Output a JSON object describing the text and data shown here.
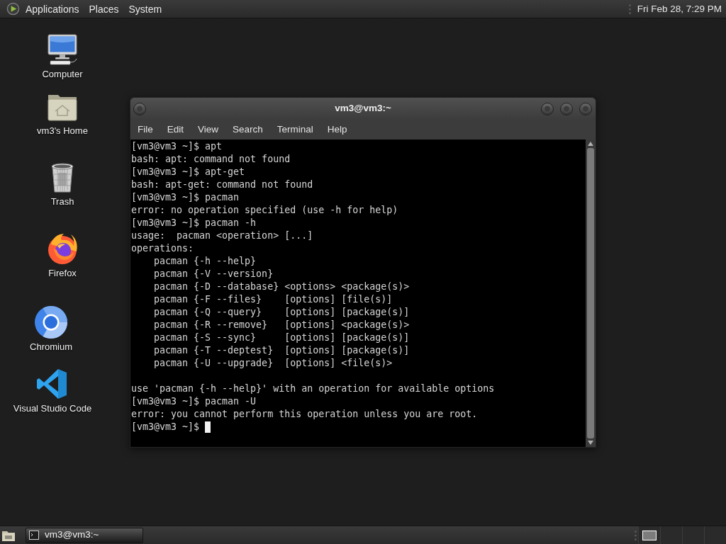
{
  "top_panel": {
    "menus": [
      "Applications",
      "Places",
      "System"
    ],
    "clock": "Fri Feb 28, 7:29 PM"
  },
  "desktop_icons": [
    {
      "label": "Computer",
      "kind": "computer"
    },
    {
      "label": "vm3's Home",
      "kind": "home"
    },
    {
      "label": "Trash",
      "kind": "trash"
    },
    {
      "label": "Firefox",
      "kind": "firefox"
    },
    {
      "label": "Chromium",
      "kind": "chromium"
    },
    {
      "label": "Visual Studio Code",
      "kind": "vscode"
    }
  ],
  "window": {
    "title": "vm3@vm3:~",
    "menus": [
      "File",
      "Edit",
      "View",
      "Search",
      "Terminal",
      "Help"
    ],
    "terminal": {
      "lines": [
        {
          "kind": "text",
          "text": "[vm3@vm3 ~]$ apt"
        },
        {
          "kind": "text",
          "text": "bash: apt: command not found"
        },
        {
          "kind": "text",
          "text": "[vm3@vm3 ~]$ apt-get"
        },
        {
          "kind": "text",
          "text": "bash: apt-get: command not found"
        },
        {
          "kind": "text",
          "text": "[vm3@vm3 ~]$ pacman"
        },
        {
          "kind": "text",
          "text": "error: no operation specified (use -h for help)"
        },
        {
          "kind": "text",
          "text": "[vm3@vm3 ~]$ pacman -h"
        },
        {
          "kind": "text",
          "text": "usage:  pacman <operation> [...]"
        },
        {
          "kind": "text",
          "text": "operations:"
        },
        {
          "kind": "text",
          "text": "    pacman {-h --help}"
        },
        {
          "kind": "text",
          "text": "    pacman {-V --version}"
        },
        {
          "kind": "text",
          "text": "    pacman {-D --database} <options> <package(s)>"
        },
        {
          "kind": "text",
          "text": "    pacman {-F --files}    [options] [file(s)]"
        },
        {
          "kind": "text",
          "text": "    pacman {-Q --query}    [options] [package(s)]"
        },
        {
          "kind": "text",
          "text": "    pacman {-R --remove}   [options] <package(s)>"
        },
        {
          "kind": "text",
          "text": "    pacman {-S --sync}     [options] [package(s)]"
        },
        {
          "kind": "text",
          "text": "    pacman {-T --deptest}  [options] [package(s)]"
        },
        {
          "kind": "text",
          "text": "    pacman {-U --upgrade}  [options] <file(s)>"
        },
        {
          "kind": "blank"
        },
        {
          "kind": "text",
          "text": "use 'pacman {-h --help}' with an operation for available options"
        },
        {
          "kind": "text",
          "text": "[vm3@vm3 ~]$ pacman -U"
        },
        {
          "kind": "text",
          "text": "error: you cannot perform this operation unless you are root."
        },
        {
          "kind": "text",
          "text": "[vm3@vm3 ~]$ "
        }
      ],
      "cursor_visible": true
    }
  },
  "bottom_panel": {
    "tasks": [
      {
        "label": "vm3@vm3:~"
      }
    ],
    "workspaces": [
      {
        "has_window": true
      },
      {
        "has_window": false
      },
      {
        "has_window": false
      },
      {
        "has_window": false
      }
    ]
  }
}
